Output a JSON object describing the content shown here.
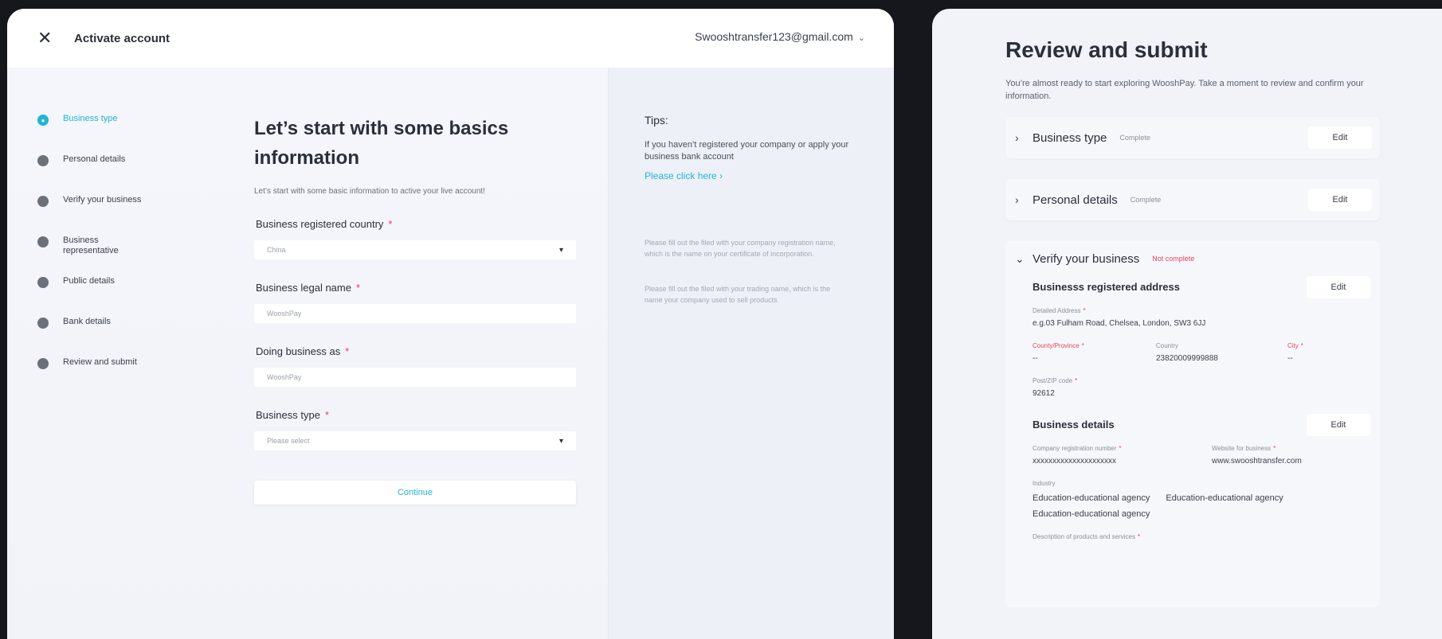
{
  "activate": {
    "title": "Activate account",
    "email": "Swooshtransfer123@gmail.com",
    "steps": [
      {
        "label": "Business type",
        "active": true
      },
      {
        "label": "Personal details",
        "active": false
      },
      {
        "label": "Verify your business",
        "active": false
      },
      {
        "label": "Business representative",
        "active": false
      },
      {
        "label": "Public details",
        "active": false
      },
      {
        "label": "Bank details",
        "active": false
      },
      {
        "label": "Review and submit",
        "active": false
      }
    ],
    "form": {
      "title": "Let’s start with some basics information",
      "subtitle": "Let’s start with some basic information to active your live account!",
      "fields": [
        {
          "label": "Business registered country",
          "value": "China",
          "select": true
        },
        {
          "label": "Business legal name",
          "value": "WooshPay",
          "select": false
        },
        {
          "label": "Doing business as",
          "value": "WooshPay",
          "select": false
        },
        {
          "label": "Business type",
          "value": "Please select",
          "select": true
        }
      ],
      "continue_label": "Continue"
    },
    "tips": {
      "title": "Tips:",
      "text": "If you haven’t registered your company or apply your business bank account",
      "link": "Please click here ›",
      "hint1": "Please fill out the filed with your company registration name, which is the name on your certificate of incorporation.",
      "hint2": "Please fill out the filed with your trading name, which is the name your company used to sell products."
    }
  },
  "review": {
    "title": "Review and submit",
    "subtitle": "You’re almost ready to start exploring WooshPay. Take a moment to review and confirm your information.",
    "edit_label": "Edit",
    "sections": [
      {
        "title": "Business type",
        "status": "Complete"
      },
      {
        "title": "Personal details",
        "status": "Complete"
      }
    ],
    "verify": {
      "title": "Verify your business",
      "status": "Not complete",
      "address": {
        "title": "Businesss registered address",
        "detailed_label": "Detailed Address",
        "detailed_value": "e.g.03 Fulham Road, Chelsea, London, SW3 6JJ",
        "county_label": "County/Province",
        "county_value": "--",
        "country_label": "Country",
        "country_value": "23820009999888",
        "city_label": "City",
        "city_value": "--",
        "post_label": "Post/ZIP code",
        "post_value": "92612"
      },
      "details": {
        "title": "Business details",
        "crn_label": "Company registration number",
        "crn_value": "xxxxxxxxxxxxxxxxxxxxx",
        "website_label": "Website for business",
        "website_value": "www.swooshtransfer.com",
        "industry_label": "Industry",
        "industry_values": [
          "Education-educational agency",
          "Education-educational agency",
          "Education-educational agency"
        ],
        "desc_label": "Description of products and services"
      }
    }
  }
}
